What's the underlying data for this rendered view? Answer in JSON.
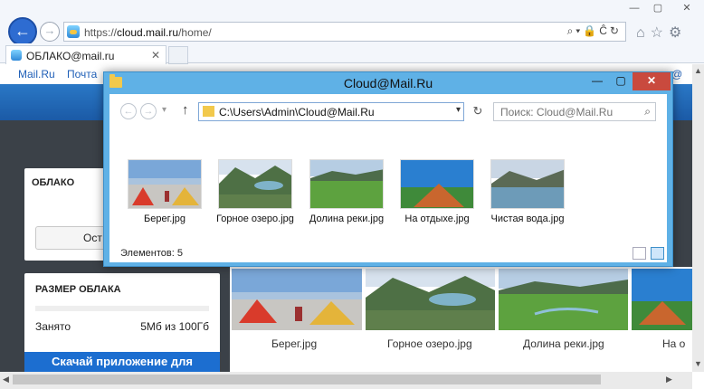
{
  "browser": {
    "address_prefix": "https://",
    "address_host": "cloud.mail.ru",
    "address_path": "/home/",
    "address_tools": "⌕▾🔒Ĉ↻",
    "tab_title": "ОБЛАКО@mail.ru",
    "tab_close": "✕",
    "back_glyph": "←",
    "fwd_glyph": "→",
    "toolbar_icons": "⌂☆⚙",
    "win_min": "—",
    "win_max": "▢",
    "win_close": "✕"
  },
  "site": {
    "nav_items": [
      "Mail.Ru",
      "Почта",
      "@"
    ],
    "cloud_title": "ОБЛАКО",
    "cloud_button": "Ост",
    "size_title": "РАЗМЕР ОБЛАКА",
    "used_label": "Занято",
    "used_value": "5Мб из 100Гб",
    "download_button": "Скачай приложение для",
    "files": [
      {
        "name": "Берег.jpg"
      },
      {
        "name": "Горное озеро.jpg"
      },
      {
        "name": "Долина реки.jpg"
      },
      {
        "name": "На о"
      }
    ]
  },
  "explorer": {
    "title": "Cloud@Mail.Ru",
    "path": "C:\\Users\\Admin\\Cloud@Mail.Ru",
    "search_placeholder": "Поиск: Cloud@Mail.Ru",
    "status": "Элементов: 5",
    "ctl_min": "—",
    "ctl_max": "▢",
    "ctl_close": "✕",
    "files": [
      {
        "name": "Берег.jpg"
      },
      {
        "name": "Горное озеро.jpg"
      },
      {
        "name": "Долина реки.jpg"
      },
      {
        "name": "На отдыхе.jpg"
      },
      {
        "name": "Чистая вода.jpg"
      }
    ]
  },
  "colors": {
    "accent_blue": "#1c6ed0",
    "explorer_frame": "#5fb1e6",
    "close_red": "#c94a3e"
  }
}
